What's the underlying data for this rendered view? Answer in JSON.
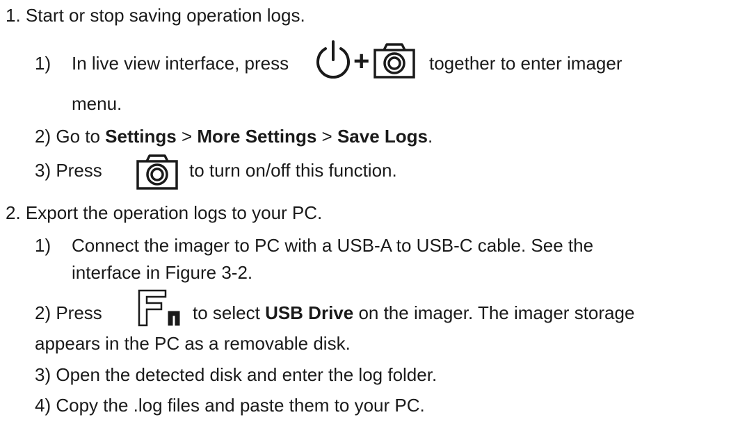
{
  "step1": {
    "heading": "1. Start or stop saving operation logs.",
    "sub1": {
      "num": "1)",
      "text_before": "In live view interface, press",
      "plus": "+",
      "text_after": "together to enter imager",
      "text_cont": "menu."
    },
    "sub2": {
      "prefix": "2) Go to ",
      "settings": "Settings",
      "sep1": " > ",
      "more_settings": "More Settings",
      "sep2": " > ",
      "save_logs": "Save Logs",
      "end": "."
    },
    "sub3": {
      "prefix": "3) Press",
      "text_after": "to turn on/off this function."
    }
  },
  "step2": {
    "heading": "2. Export the operation logs to your PC.",
    "sub1": {
      "num": "1)",
      "line1": "Connect the imager to PC with a USB-A to USB-C cable. See the",
      "line2": "interface in Figure 3-2."
    },
    "sub2": {
      "prefix": "2) Press",
      "mid": "to select ",
      "usb_drive": "USB Drive",
      "rest": " on the imager. The imager storage",
      "line2": "appears in the PC as a removable disk."
    },
    "sub3": "3) Open the detected disk and enter the log folder.",
    "sub4": "4) Copy the .log files and paste them to your PC."
  },
  "icons": {
    "power": "power-icon",
    "camera": "camera-icon",
    "fn": "fn-icon"
  }
}
